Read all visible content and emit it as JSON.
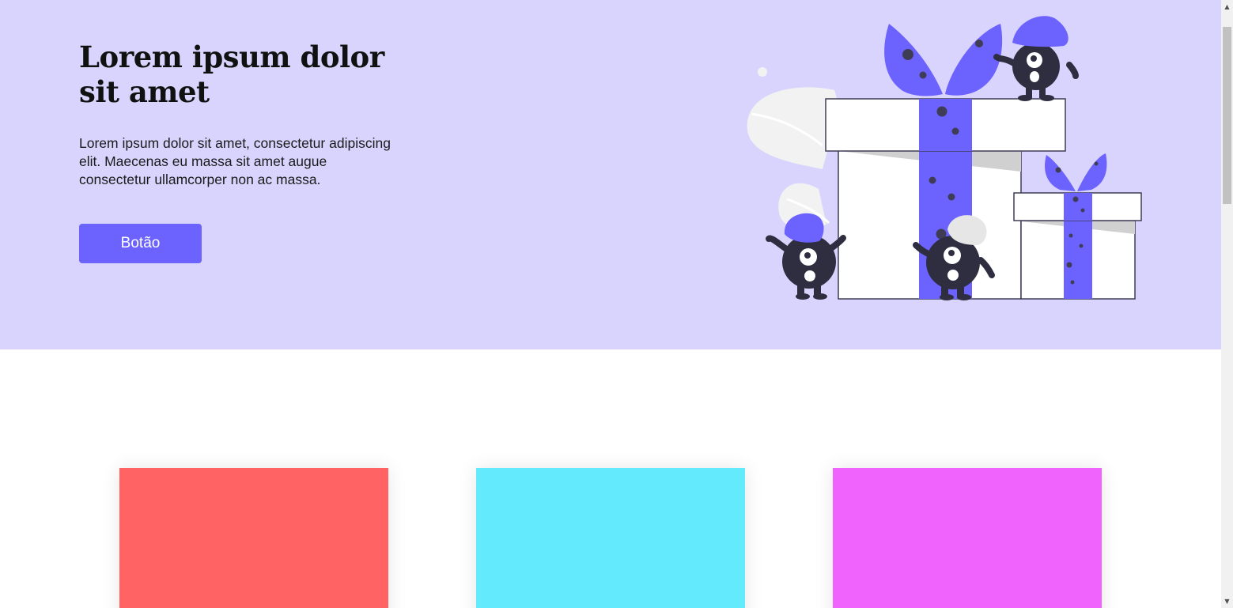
{
  "hero": {
    "title": "Lorem ipsum dolor sit amet",
    "description": "Lorem ipsum dolor sit amet, consectetur adipiscing elit. Maecenas eu massa sit amet augue consectetur ullamcorper non ac massa.",
    "button_label": "Botão",
    "background_color": "#d8d4fd",
    "accent_color": "#6c63ff"
  },
  "illustration": {
    "subject": "gift boxes with monsters"
  },
  "cards": [
    {
      "color": "#ff6363"
    },
    {
      "color": "#63eafd"
    },
    {
      "color": "#f163fd"
    }
  ],
  "scrollbar": {
    "up_arrow": "▲",
    "down_arrow": "▼"
  }
}
